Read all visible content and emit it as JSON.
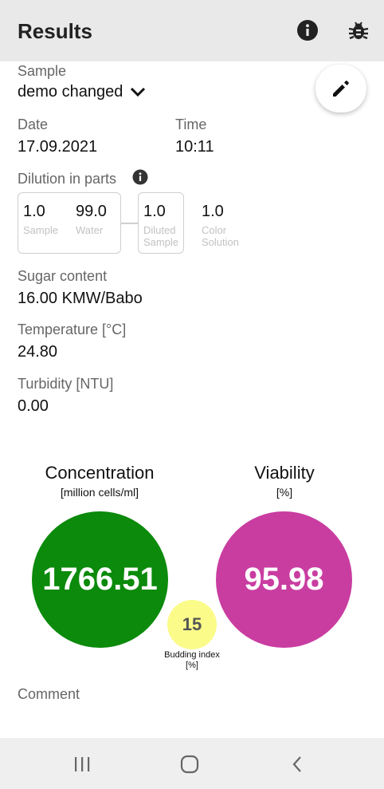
{
  "appbar": {
    "title": "Results",
    "info_icon": "info-icon",
    "bug_icon": "bug-icon"
  },
  "fab": {
    "icon": "pencil-icon"
  },
  "sample": {
    "label": "Sample",
    "value": "demo changed",
    "icon": "chevron-down-icon"
  },
  "date": {
    "label": "Date",
    "value": "17.09.2021"
  },
  "time": {
    "label": "Time",
    "value": "10:11"
  },
  "dilution": {
    "label": "Dilution in parts",
    "sample": {
      "value": "1.0",
      "caption": "Sample"
    },
    "water": {
      "value": "99.0",
      "caption": "Water"
    },
    "diluted": {
      "value": "1.0",
      "caption_line1": "Diluted",
      "caption_line2": "Sample"
    },
    "color": {
      "value": "1.0",
      "caption_line1": "Color",
      "caption_line2": "Solution"
    }
  },
  "sugar": {
    "label": "Sugar content",
    "value": "16.00 KMW/Babo"
  },
  "temperature": {
    "label": "Temperature [°C]",
    "value": "24.80"
  },
  "turbidity": {
    "label": "Turbidity [NTU]",
    "value": "0.00"
  },
  "concentration": {
    "title": "Concentration",
    "unit": "[million cells/ml]",
    "value": "1766.51",
    "color": "#0b8a0b"
  },
  "viability": {
    "title": "Viability",
    "unit": "[%]",
    "value": "95.98",
    "color": "#c93da1"
  },
  "budding": {
    "value": "15",
    "label_line1": "Budding index",
    "label_line2": "[%]",
    "color": "#fbfb8a"
  },
  "comment": {
    "label": "Comment"
  },
  "navbar": {
    "recents_icon": "recents-icon",
    "home_icon": "home-icon",
    "back_icon": "back-icon"
  }
}
